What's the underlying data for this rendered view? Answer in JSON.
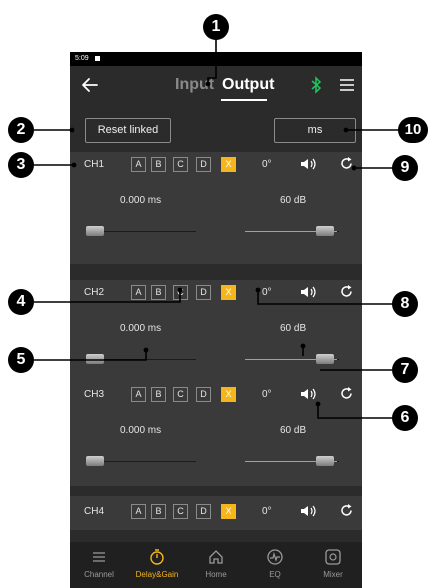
{
  "status_bar": {
    "time": "5:09"
  },
  "header": {
    "tab_input": "Input",
    "tab_output": "Output",
    "active_tab": "Output"
  },
  "toolbar": {
    "reset_label": "Reset linked",
    "unit_label": "ms"
  },
  "group_labels": [
    "A",
    "B",
    "C",
    "D",
    "X"
  ],
  "channels": [
    {
      "label": "CH1",
      "phase": "0°",
      "delay": "0.000 ms",
      "gain": "60 dB",
      "delay_level": 0.0,
      "gain_level": 1.0
    },
    {
      "label": "CH2",
      "phase": "0°",
      "delay": "0.000 ms",
      "gain": "60 dB",
      "delay_level": 0.0,
      "gain_level": 1.0
    },
    {
      "label": "CH3",
      "phase": "0°",
      "delay": "0.000 ms",
      "gain": "60 dB",
      "delay_level": 0.0,
      "gain_level": 1.0
    },
    {
      "label": "CH4",
      "phase": "0°"
    }
  ],
  "bottom_nav": [
    {
      "label": "Channel",
      "icon": "list-icon",
      "active": false
    },
    {
      "label": "Delay&Gain",
      "icon": "timer-icon",
      "active": true
    },
    {
      "label": "Home",
      "icon": "home-icon",
      "active": false
    },
    {
      "label": "EQ",
      "icon": "eq-icon",
      "active": false
    },
    {
      "label": "Mixer",
      "icon": "mixer-icon",
      "active": false
    }
  ],
  "callouts": [
    "1",
    "2",
    "3",
    "4",
    "5",
    "6",
    "7",
    "8",
    "9",
    "10"
  ],
  "colors": {
    "accent": "#f5b51b",
    "bluetooth": "#22c55e",
    "background": "#2b2b2b",
    "panel": "#3a3a3a"
  }
}
